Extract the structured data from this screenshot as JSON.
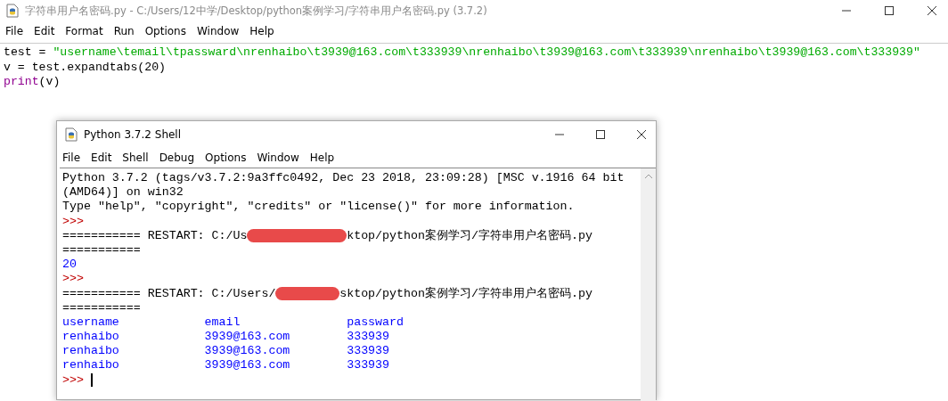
{
  "editor": {
    "title": "字符串用户名密码.py - C:/Users/12中学/Desktop/python案例学习/字符串用户名密码.py (3.7.2)",
    "menu": [
      "File",
      "Edit",
      "Format",
      "Run",
      "Options",
      "Window",
      "Help"
    ],
    "code": [
      [
        {
          "kind": "plain",
          "text": "test = "
        },
        {
          "kind": "string",
          "text": "\"username\\temail\\tpassward\\nrenhaibo\\t3939@163.com\\t333939\\nrenhaibo\\t3939@163.com\\t333939\\nrenhaibo\\t3939@163.com\\t333939\""
        }
      ],
      [
        {
          "kind": "plain",
          "text": "v = test.expandtabs(20)"
        }
      ],
      [
        {
          "kind": "builtin",
          "text": "print"
        },
        {
          "kind": "plain",
          "text": "(v)"
        }
      ]
    ]
  },
  "shell": {
    "title": "Python 3.7.2 Shell",
    "menu": [
      "File",
      "Edit",
      "Shell",
      "Debug",
      "Options",
      "Window",
      "Help"
    ],
    "lines": [
      [
        {
          "kind": "info",
          "text": "Python 3.7.2 (tags/v3.7.2:9a3ffc0492, Dec 23 2018, 23:09:28) [MSC v.1916 64 bit"
        }
      ],
      [
        {
          "kind": "info",
          "text": "(AMD64)] on win32"
        }
      ],
      [
        {
          "kind": "info",
          "text": "Type \"help\", \"copyright\", \"credits\" or \"license()\" for more information."
        }
      ],
      [
        {
          "kind": "prompt",
          "text": ">>>"
        }
      ],
      [
        {
          "kind": "info",
          "text": "=========== RESTART: C:/Us"
        },
        {
          "kind": "redacted-long"
        },
        {
          "kind": "info",
          "text": "ktop/python案例学习/字符串用户名密码.py"
        }
      ],
      [
        {
          "kind": "info",
          "text": "==========="
        }
      ],
      [
        {
          "kind": "output",
          "text": "20"
        }
      ],
      [
        {
          "kind": "prompt",
          "text": ">>>"
        }
      ],
      [
        {
          "kind": "info",
          "text": "=========== RESTART: C:/Users/"
        },
        {
          "kind": "redacted-short"
        },
        {
          "kind": "info",
          "text": "sktop/python案例学习/字符串用户名密码.py"
        }
      ],
      [
        {
          "kind": "info",
          "text": "==========="
        }
      ],
      [
        {
          "kind": "output",
          "text": "username            email               passward"
        }
      ],
      [
        {
          "kind": "output",
          "text": "renhaibo            3939@163.com        333939"
        }
      ],
      [
        {
          "kind": "output",
          "text": "renhaibo            3939@163.com        333939"
        }
      ],
      [
        {
          "kind": "output",
          "text": "renhaibo            3939@163.com        333939"
        }
      ],
      [
        {
          "kind": "prompt",
          "text": ">>> "
        },
        {
          "kind": "cursor"
        }
      ]
    ]
  }
}
